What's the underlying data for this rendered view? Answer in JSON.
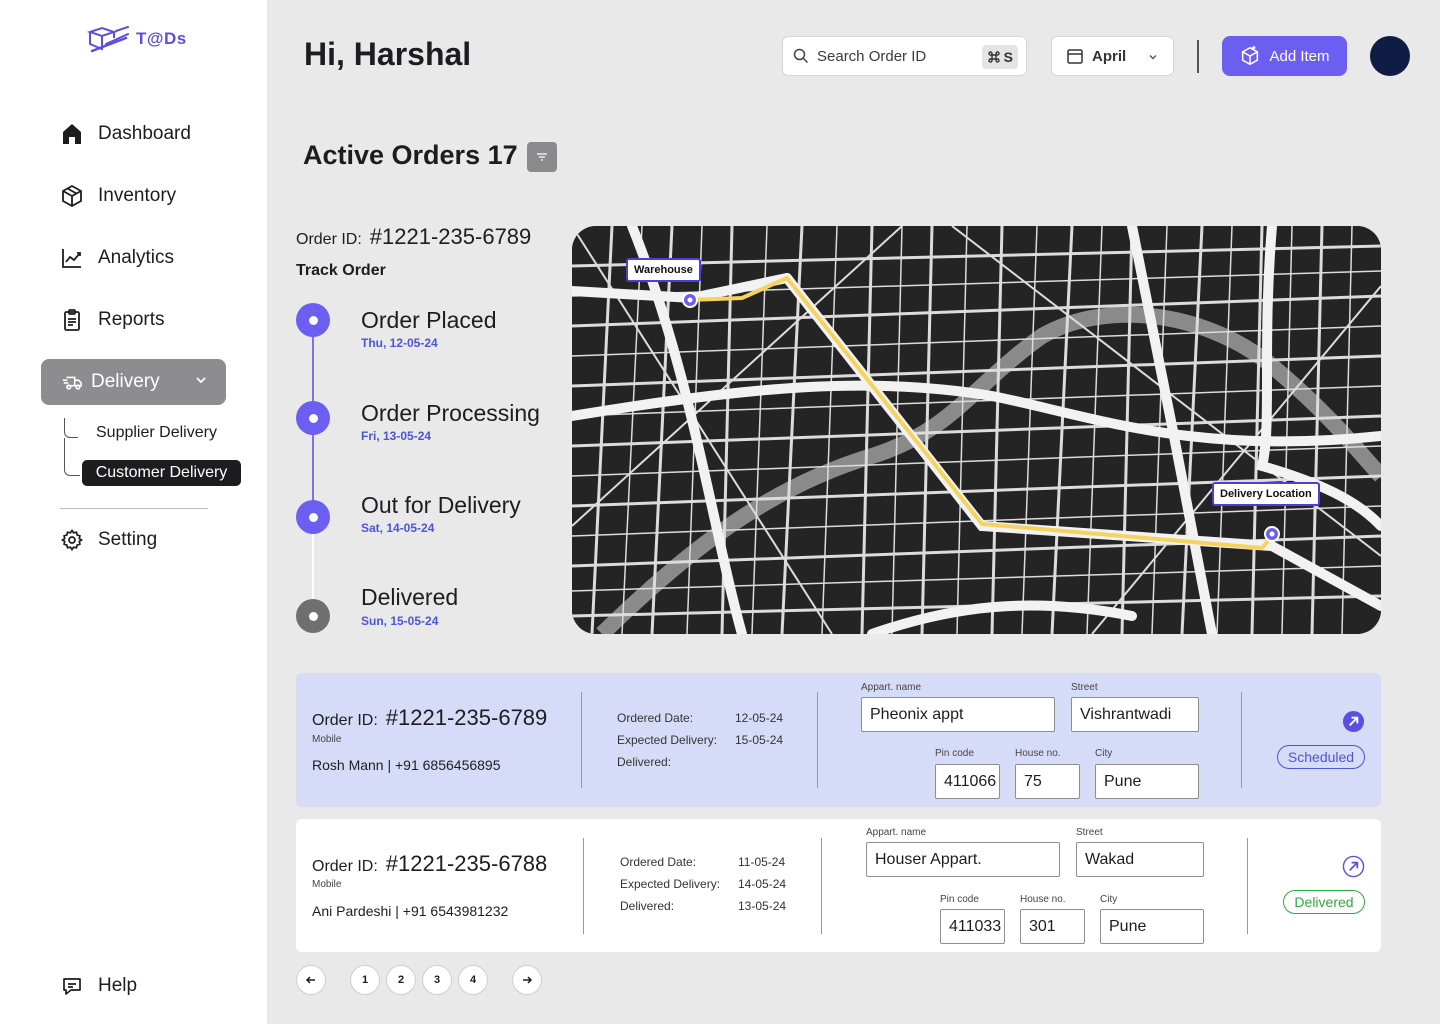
{
  "brand": {
    "name": "T@Ds",
    "accent": "#6b5ef0"
  },
  "sidebar": {
    "items": [
      {
        "label": "Dashboard",
        "icon": "home-icon"
      },
      {
        "label": "Inventory",
        "icon": "box-icon"
      },
      {
        "label": "Analytics",
        "icon": "chart-line-icon"
      },
      {
        "label": "Reports",
        "icon": "clipboard-icon"
      },
      {
        "label": "Delivery",
        "icon": "truck-icon"
      },
      {
        "label": "Setting",
        "icon": "gear-icon"
      },
      {
        "label": "Help",
        "icon": "chat-bubble-icon"
      }
    ],
    "sub_items": [
      "Supplier Delivery",
      "Customer Delivery"
    ]
  },
  "header": {
    "greeting": "Hi, Harshal",
    "search_placeholder": "Search Order ID",
    "shortcut_key": "S",
    "month": "April",
    "add_label": "Add Item"
  },
  "orders": {
    "title": "Active Orders 17"
  },
  "track": {
    "order_label": "Order ID:",
    "order_id": "#1221-235-6789",
    "title": "Track Order",
    "steps": [
      {
        "label": "Order Placed",
        "date": "Thu, 12-05-24",
        "done": true
      },
      {
        "label": "Order Processing",
        "date": "Fri, 13-05-24",
        "done": true
      },
      {
        "label": "Out for Delivery",
        "date": "Sat, 14-05-24",
        "done": true
      },
      {
        "label": "Delivered",
        "date": "Sun, 15-05-24",
        "done": false
      }
    ]
  },
  "map": {
    "start_label": "Warehouse",
    "end_label": "Delivery Location"
  },
  "cards": [
    {
      "order_label": "Order ID:",
      "order_id": "#1221-235-6789",
      "mobile_label": "Mobile",
      "contact": "Rosh Mann | +91 6856456895",
      "ordered_label": "Ordered Date:",
      "ordered": "12-05-24",
      "expected_label": "Expected Delivery:",
      "expected": "15-05-24",
      "delivered_label": "Delivered:",
      "delivered": "",
      "appart_label": "Appart. name",
      "appart": "Pheonix appt",
      "street_label": "Street",
      "street": "Vishrantwadi",
      "pin_label": "Pin code",
      "pin": "411066",
      "house_label": "House no.",
      "house": "75",
      "city_label": "City",
      "city": "Pune",
      "status": "Scheduled"
    },
    {
      "order_label": "Order ID:",
      "order_id": "#1221-235-6788",
      "mobile_label": "Mobile",
      "contact": "Ani Pardeshi | +91 6543981232",
      "ordered_label": "Ordered Date:",
      "ordered": "11-05-24",
      "expected_label": "Expected Delivery:",
      "expected": "14-05-24",
      "delivered_label": "Delivered:",
      "delivered": "13-05-24",
      "appart_label": "Appart. name",
      "appart": "Houser Appart.",
      "street_label": "Street",
      "street": "Wakad",
      "pin_label": "Pin code",
      "pin": "411033",
      "house_label": "House no.",
      "house": "301",
      "city_label": "City",
      "city": "Pune",
      "status": "Delivered"
    }
  ],
  "pagination": {
    "pages": [
      "1",
      "2",
      "3",
      "4"
    ]
  }
}
